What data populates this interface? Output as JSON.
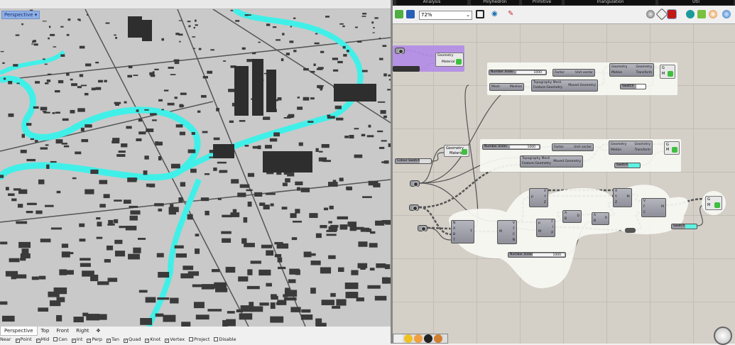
{
  "rhino": {
    "viewport_label": "Perspective",
    "viewport_tabs": [
      "Perspective",
      "Top",
      "Front",
      "Right"
    ],
    "osnaps": [
      {
        "label": "Near",
        "checked": null
      },
      {
        "label": "Point",
        "checked": true
      },
      {
        "label": "Mid",
        "checked": true
      },
      {
        "label": "Cen",
        "checked": false
      },
      {
        "label": "Int",
        "checked": true
      },
      {
        "label": "Perp",
        "checked": true
      },
      {
        "label": "Tan",
        "checked": true
      },
      {
        "label": "Quad",
        "checked": true
      },
      {
        "label": "Knot",
        "checked": true
      },
      {
        "label": "Vertex",
        "checked": true
      },
      {
        "label": "Project",
        "checked": false
      },
      {
        "label": "Disable",
        "checked": false
      }
    ],
    "colors": {
      "river": "#40f0e8",
      "buildings": "#3a3a3a",
      "ground": "#c9c9c9"
    }
  },
  "grasshopper": {
    "ribbon_tabs": [
      "Analysis",
      "Polyhedron",
      "Primitive",
      "Triangulation",
      "Util"
    ],
    "zoom": "72%",
    "toolbar_icons": [
      "open-file-icon",
      "save-icon",
      "zoom-extents-icon",
      "eye-icon",
      "sketch-icon",
      "preview-off-icon",
      "preview-wire-icon",
      "preview-shaded-icon",
      "preview-selected-icon",
      "mesh-quality-icon",
      "bake-icon",
      "sphere-icon"
    ],
    "group1": {
      "slider": {
        "label": "Number Slider",
        "value": "1000"
      },
      "amplitude": {
        "in": "Factor",
        "out": "Unit vector"
      },
      "move": {
        "in": [
          "Geometry",
          "Motion"
        ],
        "out": [
          "Geometry",
          "Transform"
        ]
      },
      "mesh": {
        "in": "Mesh",
        "out": "Meshes"
      },
      "drape": {
        "in": [
          "Topography Mesh",
          "Feature Geometry"
        ],
        "out": "Moved Geometry"
      },
      "swatch": {
        "label": "Swatch",
        "color": "#ffffff"
      },
      "preview": {
        "in": [
          "G",
          "M"
        ]
      }
    },
    "group2": {
      "slider": {
        "label": "Number Slider",
        "value": "1000"
      },
      "amplitude": {
        "in": "Factor",
        "out": "Unit vector"
      },
      "move": {
        "in": [
          "Geometry",
          "Motion"
        ],
        "out": [
          "Geometry",
          "Transform"
        ]
      },
      "drape": {
        "in": [
          "Topography Mesh",
          "Feature Geometry"
        ],
        "out": "Moved Geometry"
      },
      "swatch": {
        "label": "Swatch",
        "color": "#5ff0e0"
      },
      "preview": {
        "in": [
          "G",
          "M"
        ]
      }
    },
    "purple_group": {
      "preview": {
        "in": [
          "Geometry",
          "Material"
        ]
      },
      "color": "#b48ee6"
    },
    "material": {
      "in": [
        "Geometry",
        "Material"
      ]
    },
    "colour_swatch": {
      "label": "Colour Swatch"
    },
    "group3": {
      "c1": {
        "in": [
          "N",
          "X",
          "B",
          "T"
        ],
        "out": "T"
      },
      "c2": {
        "in": "M",
        "out": [
          "V",
          "F",
          "C",
          "N"
        ]
      },
      "c3": {
        "in": [
          "P",
          "M"
        ],
        "out": [
          "F",
          "I",
          "P"
        ]
      },
      "c4": {
        "in": "P",
        "out": [
          "X",
          "Y",
          "Z"
        ]
      },
      "c5": {
        "in": [
          "A",
          "B"
        ],
        "out": "D"
      },
      "c6": {
        "in": [
          "A",
          "B"
        ],
        "out": "R"
      },
      "c7": {
        "in": [
          "X",
          "Y",
          "Z"
        ],
        "out": "Pt"
      },
      "c8": {
        "in": [
          "V",
          "F",
          "C"
        ],
        "out": "M"
      },
      "slider": {
        "label": "Number Slider",
        "value": "1000"
      },
      "swatch": {
        "label": "Swatch",
        "color": "#5ff0e0"
      },
      "preview": {
        "in": [
          "G",
          "M"
        ]
      }
    },
    "canvas_tools": [
      "download-icon",
      "sketch-wires-icon",
      "group-icon",
      "delete-icon",
      "pen-icon"
    ]
  }
}
